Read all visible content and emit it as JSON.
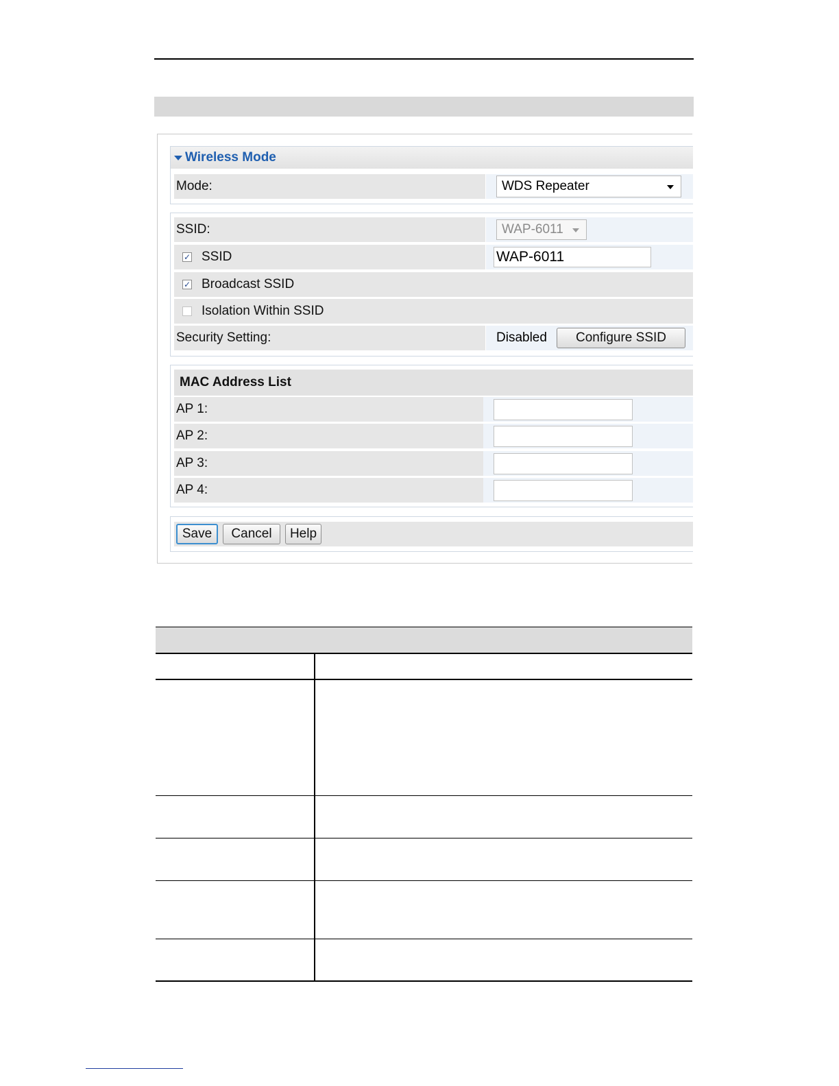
{
  "wireless_mode": {
    "title": "Wireless Mode",
    "mode_label": "Mode:",
    "mode_value": "WDS Repeater"
  },
  "ssid_group": {
    "ssid_label": "SSID:",
    "ssid_select_value": "WAP-6011",
    "ssid_checkbox_label": "SSID",
    "ssid_checked": true,
    "ssid_text_value": "WAP-6011",
    "broadcast_label": "Broadcast SSID",
    "broadcast_checked": true,
    "isolation_label": "Isolation Within SSID",
    "isolation_checked": false,
    "security_label": "Security Setting:",
    "security_value": "Disabled",
    "configure_button": "Configure SSID"
  },
  "mac_list": {
    "title": "MAC Address List",
    "aps": [
      {
        "label": "AP 1:",
        "value": ""
      },
      {
        "label": "AP 2:",
        "value": ""
      },
      {
        "label": "AP 3:",
        "value": ""
      },
      {
        "label": "AP 4:",
        "value": ""
      }
    ]
  },
  "buttons": {
    "save": "Save",
    "cancel": "Cancel",
    "help": "Help"
  }
}
